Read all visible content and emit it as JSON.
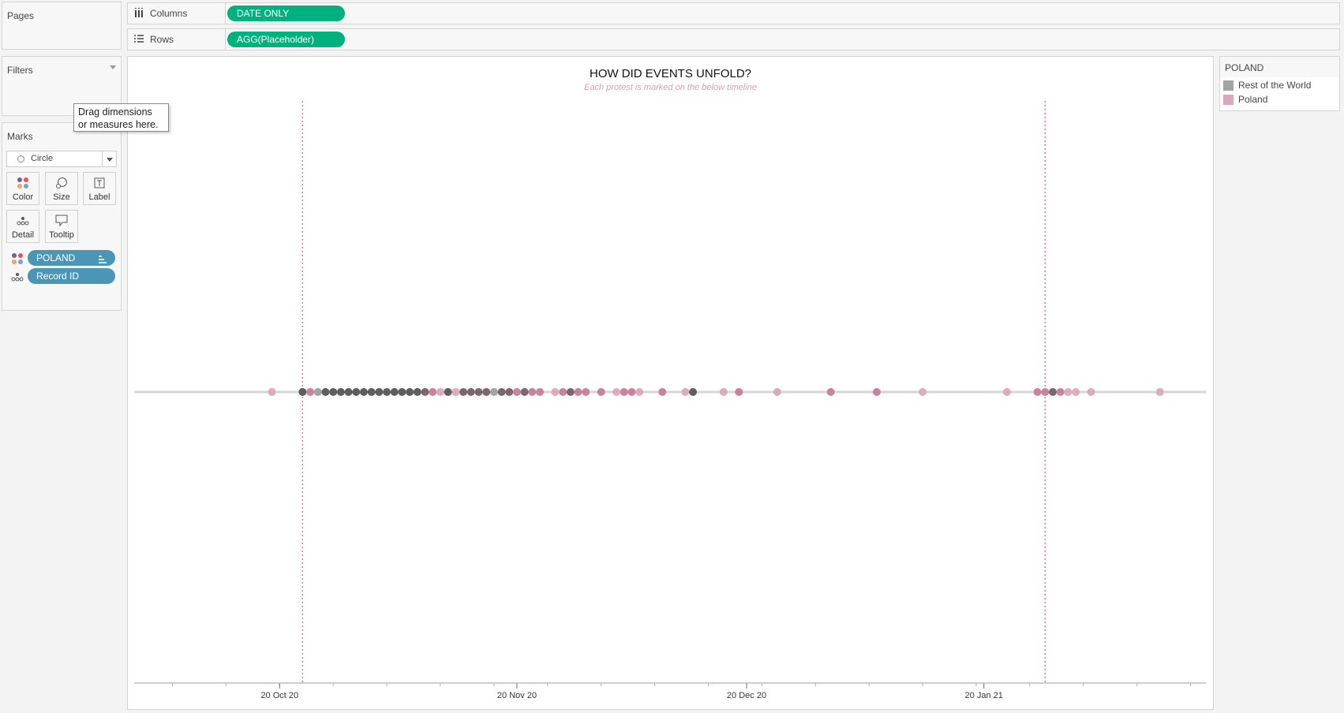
{
  "left_panel": {
    "pages_title": "Pages",
    "filters_title": "Filters",
    "marks_title": "Marks",
    "mark_type": "Circle",
    "mark_buttons": {
      "color": "Color",
      "size": "Size",
      "label": "Label",
      "detail": "Detail",
      "tooltip": "Tooltip"
    },
    "mark_fields": [
      {
        "label": "POLAND",
        "role": "color"
      },
      {
        "label": "Record ID",
        "role": "detail"
      }
    ],
    "tooltip": {
      "line1": "Drag dimensions",
      "line2": "or measures here."
    }
  },
  "shelves": {
    "columns_label": "Columns",
    "columns_pill": "DATE ONLY",
    "rows_label": "Rows",
    "rows_pill": "AGG(Placeholder)"
  },
  "legend": {
    "title": "POLAND",
    "items": [
      {
        "label": "Rest of the World",
        "color": "#a3a3a3"
      },
      {
        "label": "Poland",
        "color": "#d8a9bc"
      }
    ]
  },
  "colors": {
    "pill_green": "#00b180",
    "pill_blue": "#4a96b4",
    "reference_line": "#d9799b"
  },
  "chart_data": {
    "type": "scatter",
    "title": "HOW DID EVENTS UNFOLD?",
    "subtitle": "Each protest is marked on the below timeline",
    "xlabel": "",
    "ylabel": "",
    "x_origin_date": "2020-10-20",
    "x_unit": "days since 2020-10-20",
    "xlim": [
      -19,
      121
    ],
    "x_ticks": [
      {
        "day": 0,
        "label": "20 Oct 20"
      },
      {
        "day": 31,
        "label": "20 Nov 20"
      },
      {
        "day": 61,
        "label": "20 Dec 20"
      },
      {
        "day": 92,
        "label": "20 Jan 21"
      }
    ],
    "minor_tick_every_days": 7,
    "reference_lines_day": [
      3,
      100
    ],
    "points": [
      {
        "day": -1,
        "poland": 1,
        "world": 0
      },
      {
        "day": 3,
        "poland": 0,
        "world": 2
      },
      {
        "day": 4,
        "poland": 2,
        "world": 0
      },
      {
        "day": 5,
        "poland": 0,
        "world": 1
      },
      {
        "day": 6,
        "poland": 0,
        "world": 2
      },
      {
        "day": 7,
        "poland": 0,
        "world": 2
      },
      {
        "day": 8,
        "poland": 0,
        "world": 2
      },
      {
        "day": 9,
        "poland": 0,
        "world": 2
      },
      {
        "day": 10,
        "poland": 0,
        "world": 2
      },
      {
        "day": 11,
        "poland": 0,
        "world": 2
      },
      {
        "day": 12,
        "poland": 0,
        "world": 2
      },
      {
        "day": 13,
        "poland": 0,
        "world": 2
      },
      {
        "day": 14,
        "poland": 0,
        "world": 2
      },
      {
        "day": 15,
        "poland": 0,
        "world": 2
      },
      {
        "day": 16,
        "poland": 0,
        "world": 2
      },
      {
        "day": 17,
        "poland": 0,
        "world": 2
      },
      {
        "day": 18,
        "poland": 0,
        "world": 2
      },
      {
        "day": 19,
        "poland": 1,
        "world": 2
      },
      {
        "day": 20,
        "poland": 2,
        "world": 0
      },
      {
        "day": 21,
        "poland": 1,
        "world": 0
      },
      {
        "day": 22,
        "poland": 0,
        "world": 2
      },
      {
        "day": 23,
        "poland": 1,
        "world": 0
      },
      {
        "day": 24,
        "poland": 1,
        "world": 1
      },
      {
        "day": 25,
        "poland": 1,
        "world": 1
      },
      {
        "day": 26,
        "poland": 1,
        "world": 1
      },
      {
        "day": 27,
        "poland": 1,
        "world": 1
      },
      {
        "day": 28,
        "poland": 0,
        "world": 1
      },
      {
        "day": 29,
        "poland": 1,
        "world": 1
      },
      {
        "day": 30,
        "poland": 1,
        "world": 1
      },
      {
        "day": 31,
        "poland": 2,
        "world": 0
      },
      {
        "day": 32,
        "poland": 1,
        "world": 1
      },
      {
        "day": 33,
        "poland": 2,
        "world": 0
      },
      {
        "day": 34,
        "poland": 2,
        "world": 0
      },
      {
        "day": 36,
        "poland": 1,
        "world": 0
      },
      {
        "day": 37,
        "poland": 2,
        "world": 0
      },
      {
        "day": 38,
        "poland": 1,
        "world": 1
      },
      {
        "day": 39,
        "poland": 2,
        "world": 0
      },
      {
        "day": 40,
        "poland": 2,
        "world": 0
      },
      {
        "day": 42,
        "poland": 2,
        "world": 0
      },
      {
        "day": 44,
        "poland": 1,
        "world": 0
      },
      {
        "day": 45,
        "poland": 2,
        "world": 0
      },
      {
        "day": 46,
        "poland": 2,
        "world": 0
      },
      {
        "day": 47,
        "poland": 1,
        "world": 0
      },
      {
        "day": 50,
        "poland": 2,
        "world": 0
      },
      {
        "day": 53,
        "poland": 1,
        "world": 0
      },
      {
        "day": 54,
        "poland": 0,
        "world": 2
      },
      {
        "day": 58,
        "poland": 1,
        "world": 0
      },
      {
        "day": 60,
        "poland": 2,
        "world": 0
      },
      {
        "day": 65,
        "poland": 1,
        "world": 0
      },
      {
        "day": 72,
        "poland": 2,
        "world": 0
      },
      {
        "day": 78,
        "poland": 2,
        "world": 0
      },
      {
        "day": 84,
        "poland": 1,
        "world": 0
      },
      {
        "day": 95,
        "poland": 1,
        "world": 0
      },
      {
        "day": 99,
        "poland": 2,
        "world": 0
      },
      {
        "day": 100,
        "poland": 2,
        "world": 0
      },
      {
        "day": 101,
        "poland": 1,
        "world": 1
      },
      {
        "day": 102,
        "poland": 2,
        "world": 0
      },
      {
        "day": 103,
        "poland": 1,
        "world": 0
      },
      {
        "day": 104,
        "poland": 1,
        "world": 0
      },
      {
        "day": 106,
        "poland": 1,
        "world": 0
      },
      {
        "day": 115,
        "poland": 1,
        "world": 0
      }
    ]
  }
}
